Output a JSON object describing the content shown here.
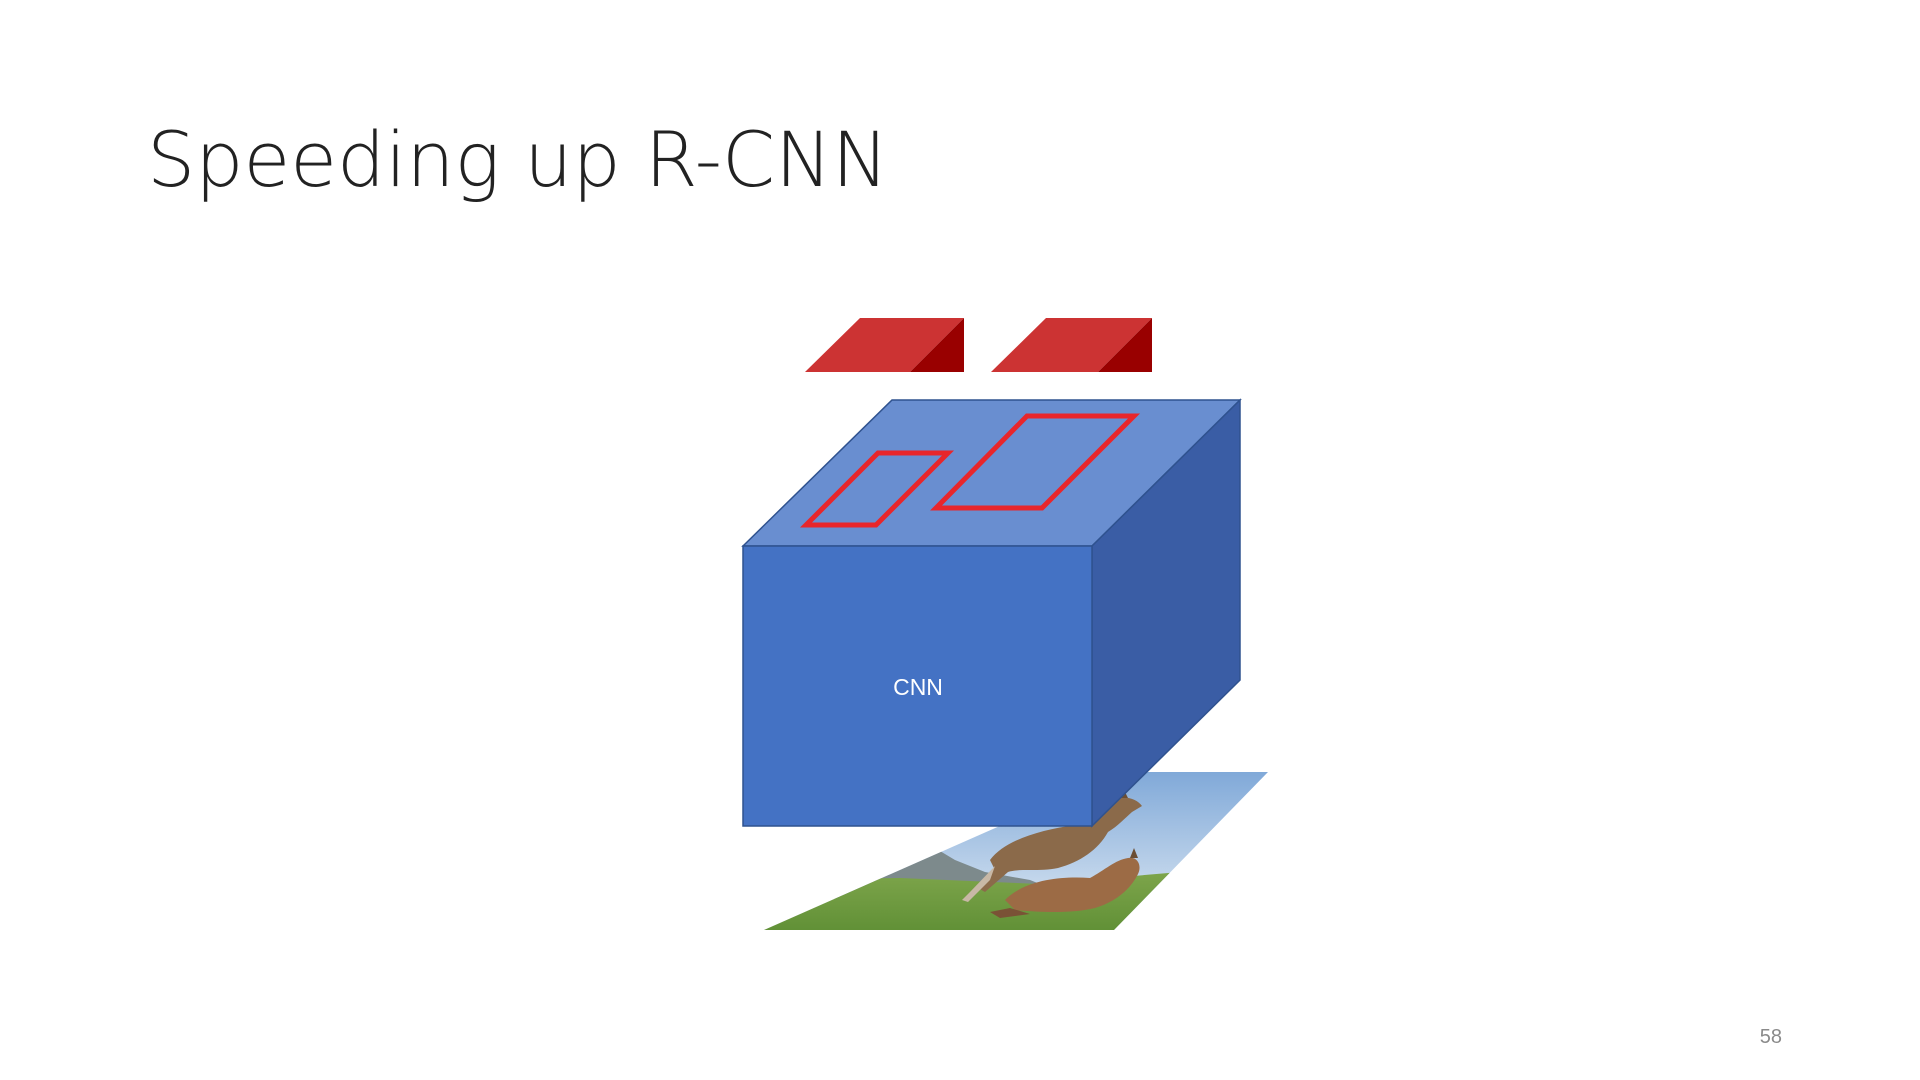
{
  "slide": {
    "title": "Speeding up R-CNN",
    "page_number": "58"
  },
  "diagram": {
    "cnn_label": "CNN",
    "colors": {
      "cube_front": "#4472C4",
      "cube_top": "#698ED0",
      "cube_side": "#3A5DA5",
      "cube_edge": "#2F528F",
      "roi_outline": "#E8262B",
      "pooled_front": "#CC3333",
      "pooled_side": "#990000",
      "sky_top": "#7FA8D8",
      "sky_bottom": "#DCE8F3",
      "grass": "#6E9A3F",
      "horse": "#8B6A4A"
    },
    "input_image": "horses-running-on-grass-photo"
  }
}
